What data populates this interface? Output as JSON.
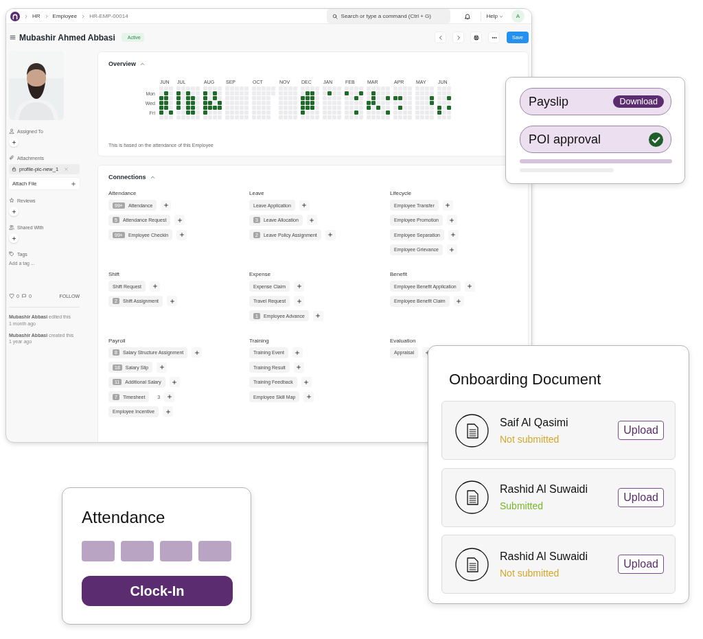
{
  "topbar": {
    "breadcrumbs": [
      "HR",
      "Employee",
      "HR-EMP-00014"
    ],
    "search": {
      "placeholder": "Search or type a command (Ctrl + G)"
    },
    "help": "Help",
    "avatar": "A"
  },
  "header": {
    "title": "Mubashir Ahmed Abbasi",
    "status": "Active",
    "save": "Save"
  },
  "sidebar": {
    "assigned_to": "Assigned To",
    "attachments": {
      "label": "Attachments",
      "files": [
        "profile-pic-new_1"
      ],
      "attach": "Attach File"
    },
    "reviews": "Reviews",
    "shared_with": "Shared With",
    "tags": {
      "label": "Tags",
      "placeholder": "Add a tag ..."
    },
    "likes": "0",
    "comments": "0",
    "follow": "FOLLOW",
    "activity": [
      {
        "text": "**Mubashir Abbasi** edited this",
        "time": "1 month ago"
      },
      {
        "text": "**Mubashir Abbasi** created this",
        "time": "1 year ago"
      }
    ]
  },
  "overview": {
    "title": "Overview",
    "days": [
      "Mon",
      "Wed",
      "Fri"
    ],
    "note": "This is based on the attendance of this Employee",
    "months": [
      {
        "label": "JUN",
        "weeks": [
          [
            false,
            false,
            true,
            true,
            true,
            true,
            false
          ],
          [
            false,
            true,
            true,
            true,
            true,
            false,
            false
          ],
          [
            false,
            false,
            false,
            false,
            false,
            true,
            false
          ]
        ]
      },
      {
        "label": "JUL",
        "weeks": [
          [
            false,
            true,
            true,
            true,
            true,
            false,
            false
          ],
          [
            false,
            false,
            false,
            false,
            false,
            false,
            false
          ],
          [
            false,
            true,
            true,
            true,
            true,
            true,
            false
          ],
          [
            false,
            false,
            true,
            true,
            true,
            true,
            false
          ],
          [
            false,
            false,
            false,
            false,
            false,
            false,
            false
          ]
        ]
      },
      {
        "label": "AUG",
        "weeks": [
          [
            false,
            true,
            true,
            true,
            true,
            true,
            false
          ],
          [
            false,
            false,
            false,
            true,
            true,
            false,
            false
          ],
          [
            false,
            true,
            true,
            false,
            true,
            false,
            false
          ],
          [
            false,
            false,
            false,
            true,
            true,
            false,
            false
          ]
        ]
      },
      {
        "label": "SEP",
        "weeks": [
          [
            false,
            false,
            false,
            false,
            false,
            false,
            false
          ],
          [
            false,
            false,
            false,
            false,
            false,
            false,
            false
          ],
          [
            false,
            false,
            false,
            false,
            false,
            false,
            false
          ],
          [
            false,
            false,
            false,
            false,
            false,
            false,
            false
          ],
          [
            false,
            false,
            false,
            false,
            false,
            false,
            false
          ]
        ]
      },
      {
        "label": "OCT",
        "weeks": [
          [
            false,
            false,
            false,
            false,
            false,
            false,
            false
          ],
          [
            false,
            false,
            false,
            false,
            false,
            false,
            false
          ],
          [
            false,
            false,
            false,
            false,
            false,
            false,
            false
          ],
          [
            false,
            false,
            false,
            false,
            false,
            false,
            false
          ],
          [
            false,
            false
          ]
        ]
      },
      {
        "label": "NOV",
        "weeks": [
          [
            false,
            false,
            false,
            false,
            false,
            false,
            false
          ],
          [
            false,
            false,
            false,
            false,
            false,
            false,
            false
          ],
          [
            false,
            false,
            false,
            false,
            false,
            false,
            false
          ],
          [
            false,
            false,
            false,
            false,
            false,
            false,
            false
          ]
        ]
      },
      {
        "label": "DEC",
        "weeks": [
          [
            false,
            false,
            true,
            true,
            true,
            true,
            false
          ],
          [
            false,
            true,
            true,
            true,
            true,
            false,
            false
          ],
          [
            false,
            true,
            true,
            true,
            true,
            false,
            false
          ],
          [
            false,
            false,
            false,
            false,
            false,
            false,
            false
          ]
        ]
      },
      {
        "label": "JAN",
        "weeks": [
          [
            false,
            false,
            false,
            false,
            false,
            false,
            false
          ],
          [
            false,
            true,
            false,
            false,
            false,
            false,
            false
          ],
          [
            false,
            false,
            false,
            false,
            false,
            false,
            false
          ],
          [
            false,
            false,
            false,
            false,
            false,
            false,
            false
          ]
        ]
      },
      {
        "label": "FEB",
        "weeks": [
          [
            false,
            true,
            false,
            false,
            false,
            false,
            false
          ],
          [
            false,
            false,
            false,
            false,
            false,
            false,
            false
          ],
          [
            false,
            false,
            true,
            false,
            false,
            true,
            false
          ],
          [
            false,
            true,
            false,
            false,
            false,
            false,
            false
          ]
        ]
      },
      {
        "label": "MAR",
        "weeks": [
          [
            false,
            false,
            false,
            true,
            true,
            false,
            false
          ],
          [
            false,
            true,
            true,
            true,
            false,
            false,
            false
          ],
          [
            false,
            false,
            false,
            false,
            true,
            false,
            false
          ],
          [
            false,
            false,
            false,
            false,
            false,
            false,
            false
          ],
          [
            false,
            false,
            true,
            false,
            false,
            true,
            false
          ]
        ]
      },
      {
        "label": "APR",
        "weeks": [
          [
            false,
            false,
            true,
            false,
            false,
            false,
            false
          ],
          [
            false,
            false,
            true,
            false,
            true,
            false,
            false
          ],
          [
            false,
            false,
            false,
            false,
            false,
            false,
            false
          ],
          [
            false,
            false,
            false,
            false,
            false,
            false,
            false
          ]
        ]
      },
      {
        "label": "MAY",
        "weeks": [
          [
            false,
            false,
            false,
            false,
            false,
            false,
            false
          ],
          [
            false,
            false,
            false,
            false,
            false,
            false,
            false
          ],
          [
            false,
            false,
            false,
            false,
            false,
            false,
            false
          ],
          [
            false,
            false,
            true,
            true,
            false,
            false,
            false
          ]
        ]
      },
      {
        "label": "JUN",
        "weeks": [
          [
            false,
            false,
            false,
            false,
            true,
            true,
            false
          ],
          [
            false,
            false,
            false,
            false,
            false,
            false,
            false
          ],
          [
            false,
            false,
            true,
            false,
            true,
            false,
            false
          ]
        ]
      }
    ]
  },
  "connections": {
    "title": "Connections",
    "groups": [
      {
        "title": "Attendance",
        "items": [
          {
            "label": "Attendance",
            "count": "99+"
          },
          {
            "label": "Attendance Request",
            "count": "5"
          },
          {
            "label": "Employee Checkin",
            "count": "99+"
          }
        ]
      },
      {
        "title": "Leave",
        "items": [
          {
            "label": "Leave Application"
          },
          {
            "label": "Leave Allocation",
            "count": "3"
          },
          {
            "label": "Leave Policy Assignment",
            "count": "2"
          }
        ]
      },
      {
        "title": "Lifecycle",
        "items": [
          {
            "label": "Employee Transfer"
          },
          {
            "label": "Employee Promotion"
          },
          {
            "label": "Employee Separation"
          },
          {
            "label": "Employee Grievance"
          }
        ]
      },
      {
        "title": "Shift",
        "items": [
          {
            "label": "Shift Request"
          },
          {
            "label": "Shift Assignment",
            "count": "2"
          }
        ]
      },
      {
        "title": "Expense",
        "items": [
          {
            "label": "Expense Claim"
          },
          {
            "label": "Travel Request"
          },
          {
            "label": "Employee Advance",
            "count": "1"
          }
        ]
      },
      {
        "title": "Benefit",
        "items": [
          {
            "label": "Employee Benefit Application"
          },
          {
            "label": "Employee Benefit Claim"
          }
        ]
      },
      {
        "title": "Payroll",
        "items": [
          {
            "label": "Salary Structure Assignment",
            "count": "8"
          },
          {
            "label": "Salary Slip",
            "count": "18"
          },
          {
            "label": "Additional Salary",
            "count": "11"
          },
          {
            "label": "Timesheet",
            "count": "7",
            "extra": "3"
          },
          {
            "label": "Employee Incentive"
          }
        ]
      },
      {
        "title": "Training",
        "items": [
          {
            "label": "Training Event"
          },
          {
            "label": "Training Result"
          },
          {
            "label": "Training Feedback"
          },
          {
            "label": "Employee Skill Map"
          }
        ]
      },
      {
        "title": "Evaluation",
        "items": [
          {
            "label": "Appraisal"
          }
        ]
      }
    ]
  },
  "payslip_card": {
    "items": [
      {
        "kind": "download",
        "label": "Payslip",
        "action": "Download"
      },
      {
        "kind": "approved",
        "label": "POI approval"
      }
    ]
  },
  "onboarding": {
    "title": "Onboarding Document",
    "documents": [
      {
        "name": "Saif Al Qasimi",
        "status": "Not submitted",
        "submitted": false,
        "action": "Upload"
      },
      {
        "name": "Rashid Al Suwaidi",
        "status": "Submitted",
        "submitted": true,
        "action": "Upload"
      },
      {
        "name": "Rashid Al Suwaidi",
        "status": "Not submitted",
        "submitted": false,
        "action": "Upload"
      }
    ]
  },
  "attendance_card": {
    "title": "Attendance",
    "button": "Clock-In"
  }
}
